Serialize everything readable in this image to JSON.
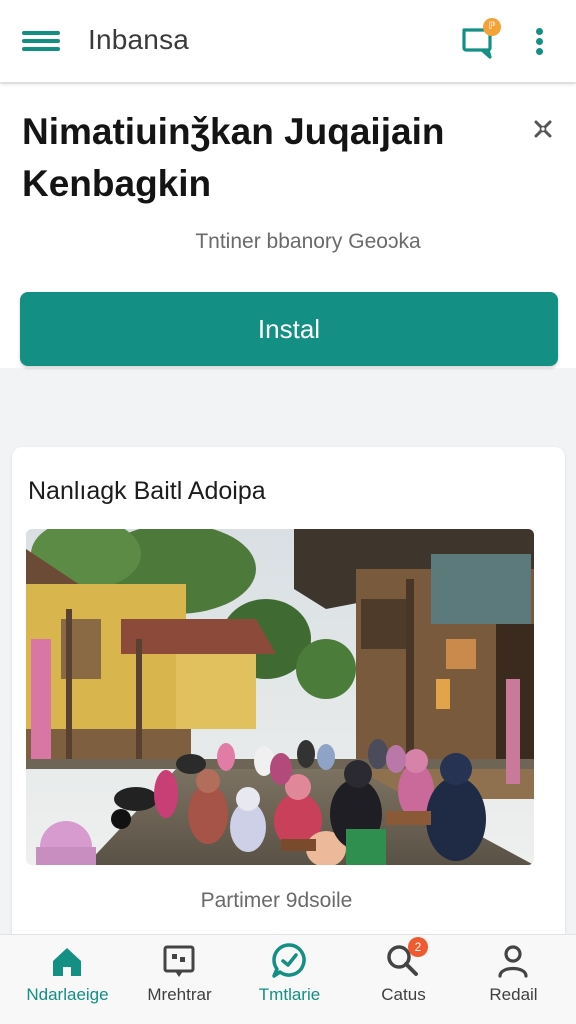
{
  "colors": {
    "accent": "#138f84",
    "chat_badge": "#f4a236",
    "search_badge": "#ef5a2e",
    "background": "#f2f3f4"
  },
  "appbar": {
    "menu_icon": "hamburger-menu-icon",
    "title": "Inbansa",
    "chat_icon": "chat-bubble-icon",
    "chat_badge": "ℙ",
    "more_icon": "more-vertical-icon"
  },
  "header": {
    "headline": "Nimatiuinǯkan Juqaijain Kenbagkin",
    "close_icon": "close-x-icon",
    "subtitle": "Tntiner bbanory Geoɔka",
    "install_label": "Instal"
  },
  "card": {
    "title": "Nanlıagk Baitl Adoipa",
    "image_alt": "Village street scene with people gathered outside wooden houses",
    "caption": "Partimer 9dsoile"
  },
  "bottom_nav": {
    "items": [
      {
        "label": "Ndarlaeige",
        "icon": "home-icon",
        "active": true
      },
      {
        "label": "Mrehtrar",
        "icon": "image-frame-icon",
        "active": false
      },
      {
        "label": "Tmtlarie",
        "icon": "chat-check-icon",
        "active": true
      },
      {
        "label": "Catus",
        "icon": "search-icon",
        "badge": "2",
        "active": false
      },
      {
        "label": "Redail",
        "icon": "profile-icon",
        "active": false
      }
    ]
  }
}
